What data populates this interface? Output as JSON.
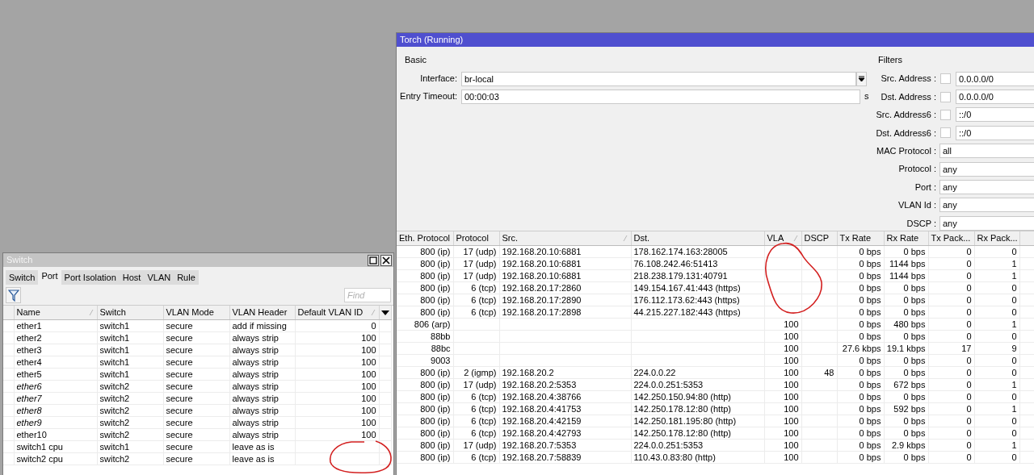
{
  "torch": {
    "title": "Torch (Running)",
    "basic": {
      "legend": "Basic",
      "interface": {
        "label": "Interface:",
        "value": "br-local"
      },
      "entry_timeout": {
        "label": "Entry Timeout:",
        "value": "00:00:03",
        "unit": "s"
      }
    },
    "filters": {
      "legend": "Filters",
      "items": [
        {
          "label": "Src. Address :",
          "kind": "checkbox",
          "checked": false,
          "value": "0.0.0.0/0"
        },
        {
          "label": "Dst. Address :",
          "kind": "checkbox",
          "checked": false,
          "value": "0.0.0.0/0"
        },
        {
          "label": "Src. Address6 :",
          "kind": "checkbox",
          "checked": false,
          "value": "::/0"
        },
        {
          "label": "Dst. Address6 :",
          "kind": "checkbox",
          "checked": false,
          "value": "::/0"
        },
        {
          "label": "MAC Protocol :",
          "kind": "plain",
          "value": "all"
        },
        {
          "label": "Protocol :",
          "kind": "plain",
          "value": "any"
        },
        {
          "label": "Port :",
          "kind": "plain",
          "value": "any"
        },
        {
          "label": "VLAN Id :",
          "kind": "plain",
          "value": "any"
        },
        {
          "label": "DSCP :",
          "kind": "plain",
          "value": "any"
        }
      ]
    },
    "table": {
      "columns": [
        {
          "label": "Eth. Protocol",
          "sorted": false
        },
        {
          "label": "Protocol",
          "sorted": false
        },
        {
          "label": "Src.",
          "sorted": true
        },
        {
          "label": "Dst.",
          "sorted": false
        },
        {
          "label": "VLA",
          "sorted": true
        },
        {
          "label": "DSCP",
          "sorted": false
        },
        {
          "label": "Tx Rate",
          "sorted": false
        },
        {
          "label": "Rx Rate",
          "sorted": false
        },
        {
          "label": "Tx Pack...",
          "sorted": false
        },
        {
          "label": "Rx Pack...",
          "sorted": false
        }
      ],
      "rows": [
        [
          "800 (ip)",
          "17 (udp)",
          "192.168.20.10:6881",
          "178.162.174.163:28005",
          null,
          null,
          "0 bps",
          "0 bps",
          "0",
          "0"
        ],
        [
          "800 (ip)",
          "17 (udp)",
          "192.168.20.10:6881",
          "76.108.242.46:51413",
          null,
          null,
          "0 bps",
          "1144 bps",
          "0",
          "1"
        ],
        [
          "800 (ip)",
          "17 (udp)",
          "192.168.20.10:6881",
          "218.238.179.131:40791",
          null,
          null,
          "0 bps",
          "1144 bps",
          "0",
          "1"
        ],
        [
          "800 (ip)",
          "6 (tcp)",
          "192.168.20.17:2860",
          "149.154.167.41:443 (https)",
          null,
          null,
          "0 bps",
          "0 bps",
          "0",
          "0"
        ],
        [
          "800 (ip)",
          "6 (tcp)",
          "192.168.20.17:2890",
          "176.112.173.62:443 (https)",
          null,
          null,
          "0 bps",
          "0 bps",
          "0",
          "0"
        ],
        [
          "800 (ip)",
          "6 (tcp)",
          "192.168.20.17:2898",
          "44.215.227.182:443 (https)",
          null,
          null,
          "0 bps",
          "0 bps",
          "0",
          "0"
        ],
        [
          "806 (arp)",
          null,
          null,
          null,
          "100",
          null,
          "0 bps",
          "480 bps",
          "0",
          "1"
        ],
        [
          "88bb",
          null,
          null,
          null,
          "100",
          null,
          "0 bps",
          "0 bps",
          "0",
          "0"
        ],
        [
          "88bc",
          null,
          null,
          null,
          "100",
          null,
          "27.6 kbps",
          "19.1 kbps",
          "17",
          "9"
        ],
        [
          "9003",
          null,
          null,
          null,
          "100",
          null,
          "0 bps",
          "0 bps",
          "0",
          "0"
        ],
        [
          "800 (ip)",
          "2 (igmp)",
          "192.168.20.2",
          "224.0.0.22",
          "100",
          "48",
          "0 bps",
          "0 bps",
          "0",
          "0"
        ],
        [
          "800 (ip)",
          "17 (udp)",
          "192.168.20.2:5353",
          "224.0.0.251:5353",
          "100",
          null,
          "0 bps",
          "672 bps",
          "0",
          "1"
        ],
        [
          "800 (ip)",
          "6 (tcp)",
          "192.168.20.4:38766",
          "142.250.150.94:80 (http)",
          "100",
          null,
          "0 bps",
          "0 bps",
          "0",
          "0"
        ],
        [
          "800 (ip)",
          "6 (tcp)",
          "192.168.20.4:41753",
          "142.250.178.12:80 (http)",
          "100",
          null,
          "0 bps",
          "592 bps",
          "0",
          "1"
        ],
        [
          "800 (ip)",
          "6 (tcp)",
          "192.168.20.4:42159",
          "142.250.181.195:80 (http)",
          "100",
          null,
          "0 bps",
          "0 bps",
          "0",
          "0"
        ],
        [
          "800 (ip)",
          "6 (tcp)",
          "192.168.20.4:42793",
          "142.250.178.12:80 (http)",
          "100",
          null,
          "0 bps",
          "0 bps",
          "0",
          "0"
        ],
        [
          "800 (ip)",
          "17 (udp)",
          "192.168.20.7:5353",
          "224.0.0.251:5353",
          "100",
          null,
          "0 bps",
          "2.9 kbps",
          "0",
          "1"
        ],
        [
          "800 (ip)",
          "6 (tcp)",
          "192.168.20.7:58839",
          "110.43.0.83:80 (http)",
          "100",
          null,
          "0 bps",
          "0 bps",
          "0",
          "0"
        ]
      ]
    }
  },
  "switch": {
    "title": "Switch",
    "tabs": [
      {
        "label": "Switch",
        "selected": false
      },
      {
        "label": "Port",
        "selected": true
      },
      {
        "label": "Port Isolation",
        "selected": false
      },
      {
        "label": "Host",
        "selected": false
      },
      {
        "label": "VLAN",
        "selected": false
      },
      {
        "label": "Rule",
        "selected": false
      }
    ],
    "search": {
      "placeholder": "Find"
    },
    "table": {
      "columns": [
        {
          "label": "Name",
          "sorted": true
        },
        {
          "label": "Switch",
          "sorted": false
        },
        {
          "label": "VLAN Mode",
          "sorted": false
        },
        {
          "label": "VLAN Header",
          "sorted": false
        },
        {
          "label": "Default VLAN ID",
          "sorted": true
        }
      ],
      "rows": [
        {
          "cells": [
            "ether1",
            "switch1",
            "secure",
            "add if missing",
            "0"
          ],
          "inactive": false
        },
        {
          "cells": [
            "ether2",
            "switch1",
            "secure",
            "always strip",
            "100"
          ],
          "inactive": false
        },
        {
          "cells": [
            "ether3",
            "switch1",
            "secure",
            "always strip",
            "100"
          ],
          "inactive": false
        },
        {
          "cells": [
            "ether4",
            "switch1",
            "secure",
            "always strip",
            "100"
          ],
          "inactive": false
        },
        {
          "cells": [
            "ether5",
            "switch1",
            "secure",
            "always strip",
            "100"
          ],
          "inactive": false
        },
        {
          "cells": [
            "ether6",
            "switch2",
            "secure",
            "always strip",
            "100"
          ],
          "inactive": true
        },
        {
          "cells": [
            "ether7",
            "switch2",
            "secure",
            "always strip",
            "100"
          ],
          "inactive": true
        },
        {
          "cells": [
            "ether8",
            "switch2",
            "secure",
            "always strip",
            "100"
          ],
          "inactive": true
        },
        {
          "cells": [
            "ether9",
            "switch2",
            "secure",
            "always strip",
            "100"
          ],
          "inactive": true
        },
        {
          "cells": [
            "ether10",
            "switch2",
            "secure",
            "always strip",
            "100"
          ],
          "inactive": false
        },
        {
          "cells": [
            "switch1 cpu",
            "switch1",
            "secure",
            "leave as is",
            null
          ],
          "inactive": false
        },
        {
          "cells": [
            "switch2 cpu",
            "switch2",
            "secure",
            "leave as is",
            null
          ],
          "inactive": false
        }
      ]
    }
  }
}
